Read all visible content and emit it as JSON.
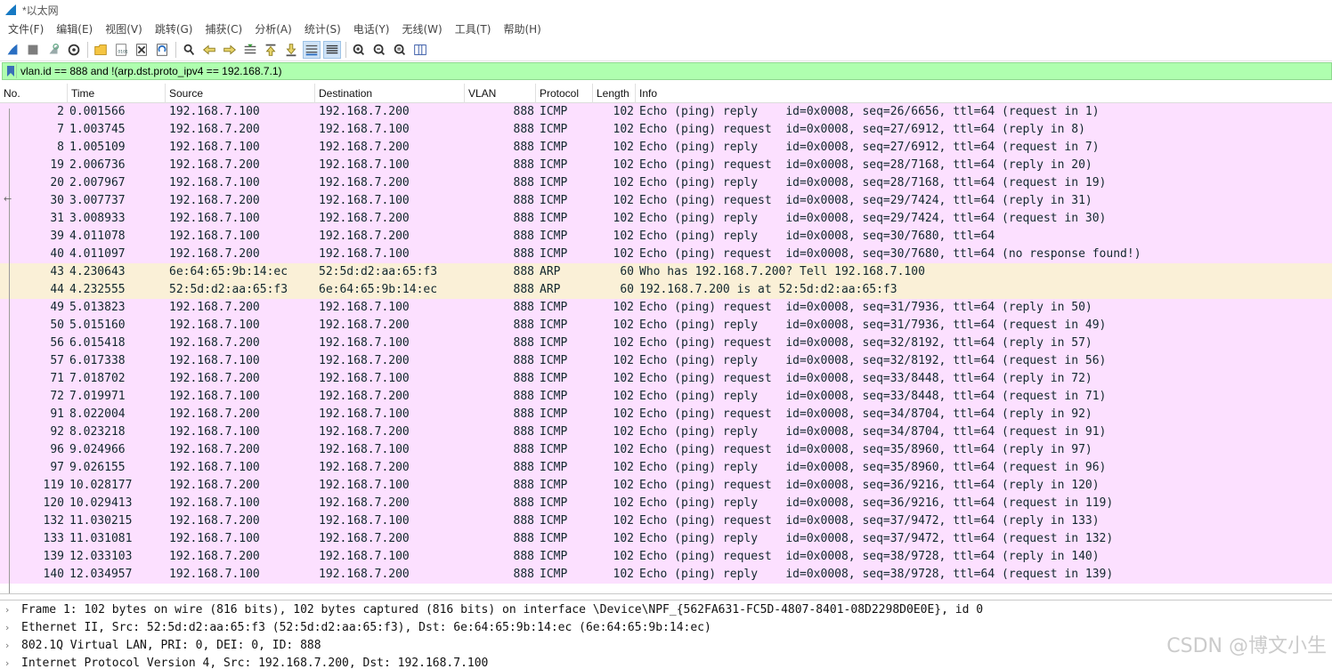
{
  "window": {
    "title": "*以太网"
  },
  "menu": [
    {
      "label": "文件(F)",
      "name": "menu-file"
    },
    {
      "label": "编辑(E)",
      "name": "menu-edit"
    },
    {
      "label": "视图(V)",
      "name": "menu-view"
    },
    {
      "label": "跳转(G)",
      "name": "menu-go"
    },
    {
      "label": "捕获(C)",
      "name": "menu-capture"
    },
    {
      "label": "分析(A)",
      "name": "menu-analyze"
    },
    {
      "label": "统计(S)",
      "name": "menu-statistics"
    },
    {
      "label": "电话(Y)",
      "name": "menu-telephony"
    },
    {
      "label": "无线(W)",
      "name": "menu-wireless"
    },
    {
      "label": "工具(T)",
      "name": "menu-tools"
    },
    {
      "label": "帮助(H)",
      "name": "menu-help"
    }
  ],
  "toolbar_icons": [
    "start-capture-icon",
    "stop-capture-icon",
    "restart-capture-icon",
    "capture-options-icon",
    "sep",
    "open-file-icon",
    "save-file-icon",
    "close-file-icon",
    "reload-file-icon",
    "sep",
    "find-packet-icon",
    "go-back-icon",
    "go-forward-icon",
    "go-to-packet-icon",
    "go-first-icon",
    "go-last-icon",
    "auto-scroll-icon",
    "colorize-icon",
    "sep",
    "zoom-in-icon",
    "zoom-out-icon",
    "zoom-normal-icon",
    "resize-columns-icon"
  ],
  "filter": {
    "value": "vlan.id == 888 and !(arp.dst.proto_ipv4 == 192.168.7.1)"
  },
  "columns": [
    "No.",
    "Time",
    "Source",
    "Destination",
    "VLAN",
    "Protocol",
    "Length",
    "Info"
  ],
  "packets": [
    {
      "no": "2",
      "time": "0.001566",
      "src": "192.168.7.100",
      "dst": "192.168.7.200",
      "vlan": "888",
      "proto": "ICMP",
      "len": "102",
      "info": "Echo (ping) reply    id=0x0008, seq=26/6656, ttl=64 (request in 1)"
    },
    {
      "no": "7",
      "time": "1.003745",
      "src": "192.168.7.200",
      "dst": "192.168.7.100",
      "vlan": "888",
      "proto": "ICMP",
      "len": "102",
      "info": "Echo (ping) request  id=0x0008, seq=27/6912, ttl=64 (reply in 8)"
    },
    {
      "no": "8",
      "time": "1.005109",
      "src": "192.168.7.100",
      "dst": "192.168.7.200",
      "vlan": "888",
      "proto": "ICMP",
      "len": "102",
      "info": "Echo (ping) reply    id=0x0008, seq=27/6912, ttl=64 (request in 7)"
    },
    {
      "no": "19",
      "time": "2.006736",
      "src": "192.168.7.200",
      "dst": "192.168.7.100",
      "vlan": "888",
      "proto": "ICMP",
      "len": "102",
      "info": "Echo (ping) request  id=0x0008, seq=28/7168, ttl=64 (reply in 20)"
    },
    {
      "no": "20",
      "time": "2.007967",
      "src": "192.168.7.100",
      "dst": "192.168.7.200",
      "vlan": "888",
      "proto": "ICMP",
      "len": "102",
      "info": "Echo (ping) reply    id=0x0008, seq=28/7168, ttl=64 (request in 19)"
    },
    {
      "no": "30",
      "time": "3.007737",
      "src": "192.168.7.200",
      "dst": "192.168.7.100",
      "vlan": "888",
      "proto": "ICMP",
      "len": "102",
      "info": "Echo (ping) request  id=0x0008, seq=29/7424, ttl=64 (reply in 31)"
    },
    {
      "no": "31",
      "time": "3.008933",
      "src": "192.168.7.100",
      "dst": "192.168.7.200",
      "vlan": "888",
      "proto": "ICMP",
      "len": "102",
      "info": "Echo (ping) reply    id=0x0008, seq=29/7424, ttl=64 (request in 30)"
    },
    {
      "no": "39",
      "time": "4.011078",
      "src": "192.168.7.100",
      "dst": "192.168.7.200",
      "vlan": "888",
      "proto": "ICMP",
      "len": "102",
      "info": "Echo (ping) reply    id=0x0008, seq=30/7680, ttl=64"
    },
    {
      "no": "40",
      "time": "4.011097",
      "src": "192.168.7.200",
      "dst": "192.168.7.100",
      "vlan": "888",
      "proto": "ICMP",
      "len": "102",
      "info": "Echo (ping) request  id=0x0008, seq=30/7680, ttl=64 (no response found!)"
    },
    {
      "no": "43",
      "time": "4.230643",
      "src": "6e:64:65:9b:14:ec",
      "dst": "52:5d:d2:aa:65:f3",
      "vlan": "888",
      "proto": "ARP",
      "len": "60",
      "info": "Who has 192.168.7.200? Tell 192.168.7.100"
    },
    {
      "no": "44",
      "time": "4.232555",
      "src": "52:5d:d2:aa:65:f3",
      "dst": "6e:64:65:9b:14:ec",
      "vlan": "888",
      "proto": "ARP",
      "len": "60",
      "info": "192.168.7.200 is at 52:5d:d2:aa:65:f3"
    },
    {
      "no": "49",
      "time": "5.013823",
      "src": "192.168.7.200",
      "dst": "192.168.7.100",
      "vlan": "888",
      "proto": "ICMP",
      "len": "102",
      "info": "Echo (ping) request  id=0x0008, seq=31/7936, ttl=64 (reply in 50)"
    },
    {
      "no": "50",
      "time": "5.015160",
      "src": "192.168.7.100",
      "dst": "192.168.7.200",
      "vlan": "888",
      "proto": "ICMP",
      "len": "102",
      "info": "Echo (ping) reply    id=0x0008, seq=31/7936, ttl=64 (request in 49)"
    },
    {
      "no": "56",
      "time": "6.015418",
      "src": "192.168.7.200",
      "dst": "192.168.7.100",
      "vlan": "888",
      "proto": "ICMP",
      "len": "102",
      "info": "Echo (ping) request  id=0x0008, seq=32/8192, ttl=64 (reply in 57)"
    },
    {
      "no": "57",
      "time": "6.017338",
      "src": "192.168.7.100",
      "dst": "192.168.7.200",
      "vlan": "888",
      "proto": "ICMP",
      "len": "102",
      "info": "Echo (ping) reply    id=0x0008, seq=32/8192, ttl=64 (request in 56)"
    },
    {
      "no": "71",
      "time": "7.018702",
      "src": "192.168.7.200",
      "dst": "192.168.7.100",
      "vlan": "888",
      "proto": "ICMP",
      "len": "102",
      "info": "Echo (ping) request  id=0x0008, seq=33/8448, ttl=64 (reply in 72)"
    },
    {
      "no": "72",
      "time": "7.019971",
      "src": "192.168.7.100",
      "dst": "192.168.7.200",
      "vlan": "888",
      "proto": "ICMP",
      "len": "102",
      "info": "Echo (ping) reply    id=0x0008, seq=33/8448, ttl=64 (request in 71)"
    },
    {
      "no": "91",
      "time": "8.022004",
      "src": "192.168.7.200",
      "dst": "192.168.7.100",
      "vlan": "888",
      "proto": "ICMP",
      "len": "102",
      "info": "Echo (ping) request  id=0x0008, seq=34/8704, ttl=64 (reply in 92)"
    },
    {
      "no": "92",
      "time": "8.023218",
      "src": "192.168.7.100",
      "dst": "192.168.7.200",
      "vlan": "888",
      "proto": "ICMP",
      "len": "102",
      "info": "Echo (ping) reply    id=0x0008, seq=34/8704, ttl=64 (request in 91)"
    },
    {
      "no": "96",
      "time": "9.024966",
      "src": "192.168.7.200",
      "dst": "192.168.7.100",
      "vlan": "888",
      "proto": "ICMP",
      "len": "102",
      "info": "Echo (ping) request  id=0x0008, seq=35/8960, ttl=64 (reply in 97)"
    },
    {
      "no": "97",
      "time": "9.026155",
      "src": "192.168.7.100",
      "dst": "192.168.7.200",
      "vlan": "888",
      "proto": "ICMP",
      "len": "102",
      "info": "Echo (ping) reply    id=0x0008, seq=35/8960, ttl=64 (request in 96)"
    },
    {
      "no": "119",
      "time": "10.028177",
      "src": "192.168.7.200",
      "dst": "192.168.7.100",
      "vlan": "888",
      "proto": "ICMP",
      "len": "102",
      "info": "Echo (ping) request  id=0x0008, seq=36/9216, ttl=64 (reply in 120)"
    },
    {
      "no": "120",
      "time": "10.029413",
      "src": "192.168.7.100",
      "dst": "192.168.7.200",
      "vlan": "888",
      "proto": "ICMP",
      "len": "102",
      "info": "Echo (ping) reply    id=0x0008, seq=36/9216, ttl=64 (request in 119)"
    },
    {
      "no": "132",
      "time": "11.030215",
      "src": "192.168.7.200",
      "dst": "192.168.7.100",
      "vlan": "888",
      "proto": "ICMP",
      "len": "102",
      "info": "Echo (ping) request  id=0x0008, seq=37/9472, ttl=64 (reply in 133)"
    },
    {
      "no": "133",
      "time": "11.031081",
      "src": "192.168.7.100",
      "dst": "192.168.7.200",
      "vlan": "888",
      "proto": "ICMP",
      "len": "102",
      "info": "Echo (ping) reply    id=0x0008, seq=37/9472, ttl=64 (request in 132)"
    },
    {
      "no": "139",
      "time": "12.033103",
      "src": "192.168.7.200",
      "dst": "192.168.7.100",
      "vlan": "888",
      "proto": "ICMP",
      "len": "102",
      "info": "Echo (ping) request  id=0x0008, seq=38/9728, ttl=64 (reply in 140)"
    },
    {
      "no": "140",
      "time": "12.034957",
      "src": "192.168.7.100",
      "dst": "192.168.7.200",
      "vlan": "888",
      "proto": "ICMP",
      "len": "102",
      "info": "Echo (ping) reply    id=0x0008, seq=38/9728, ttl=64 (request in 139)"
    }
  ],
  "details": [
    "Frame 1: 102 bytes on wire (816 bits), 102 bytes captured (816 bits) on interface \\Device\\NPF_{562FA631-FC5D-4807-8401-08D2298D0E0E}, id 0",
    "Ethernet II, Src: 52:5d:d2:aa:65:f3 (52:5d:d2:aa:65:f3), Dst: 6e:64:65:9b:14:ec (6e:64:65:9b:14:ec)",
    "802.1Q Virtual LAN, PRI: 0, DEI: 0, ID: 888",
    "Internet Protocol Version 4, Src: 192.168.7.200, Dst: 192.168.7.100"
  ],
  "watermark": "CSDN @博文小生",
  "colors": {
    "icmp_row": "#fce0ff",
    "arp_row": "#faf0d7",
    "filter_bg": "#afffaf"
  }
}
